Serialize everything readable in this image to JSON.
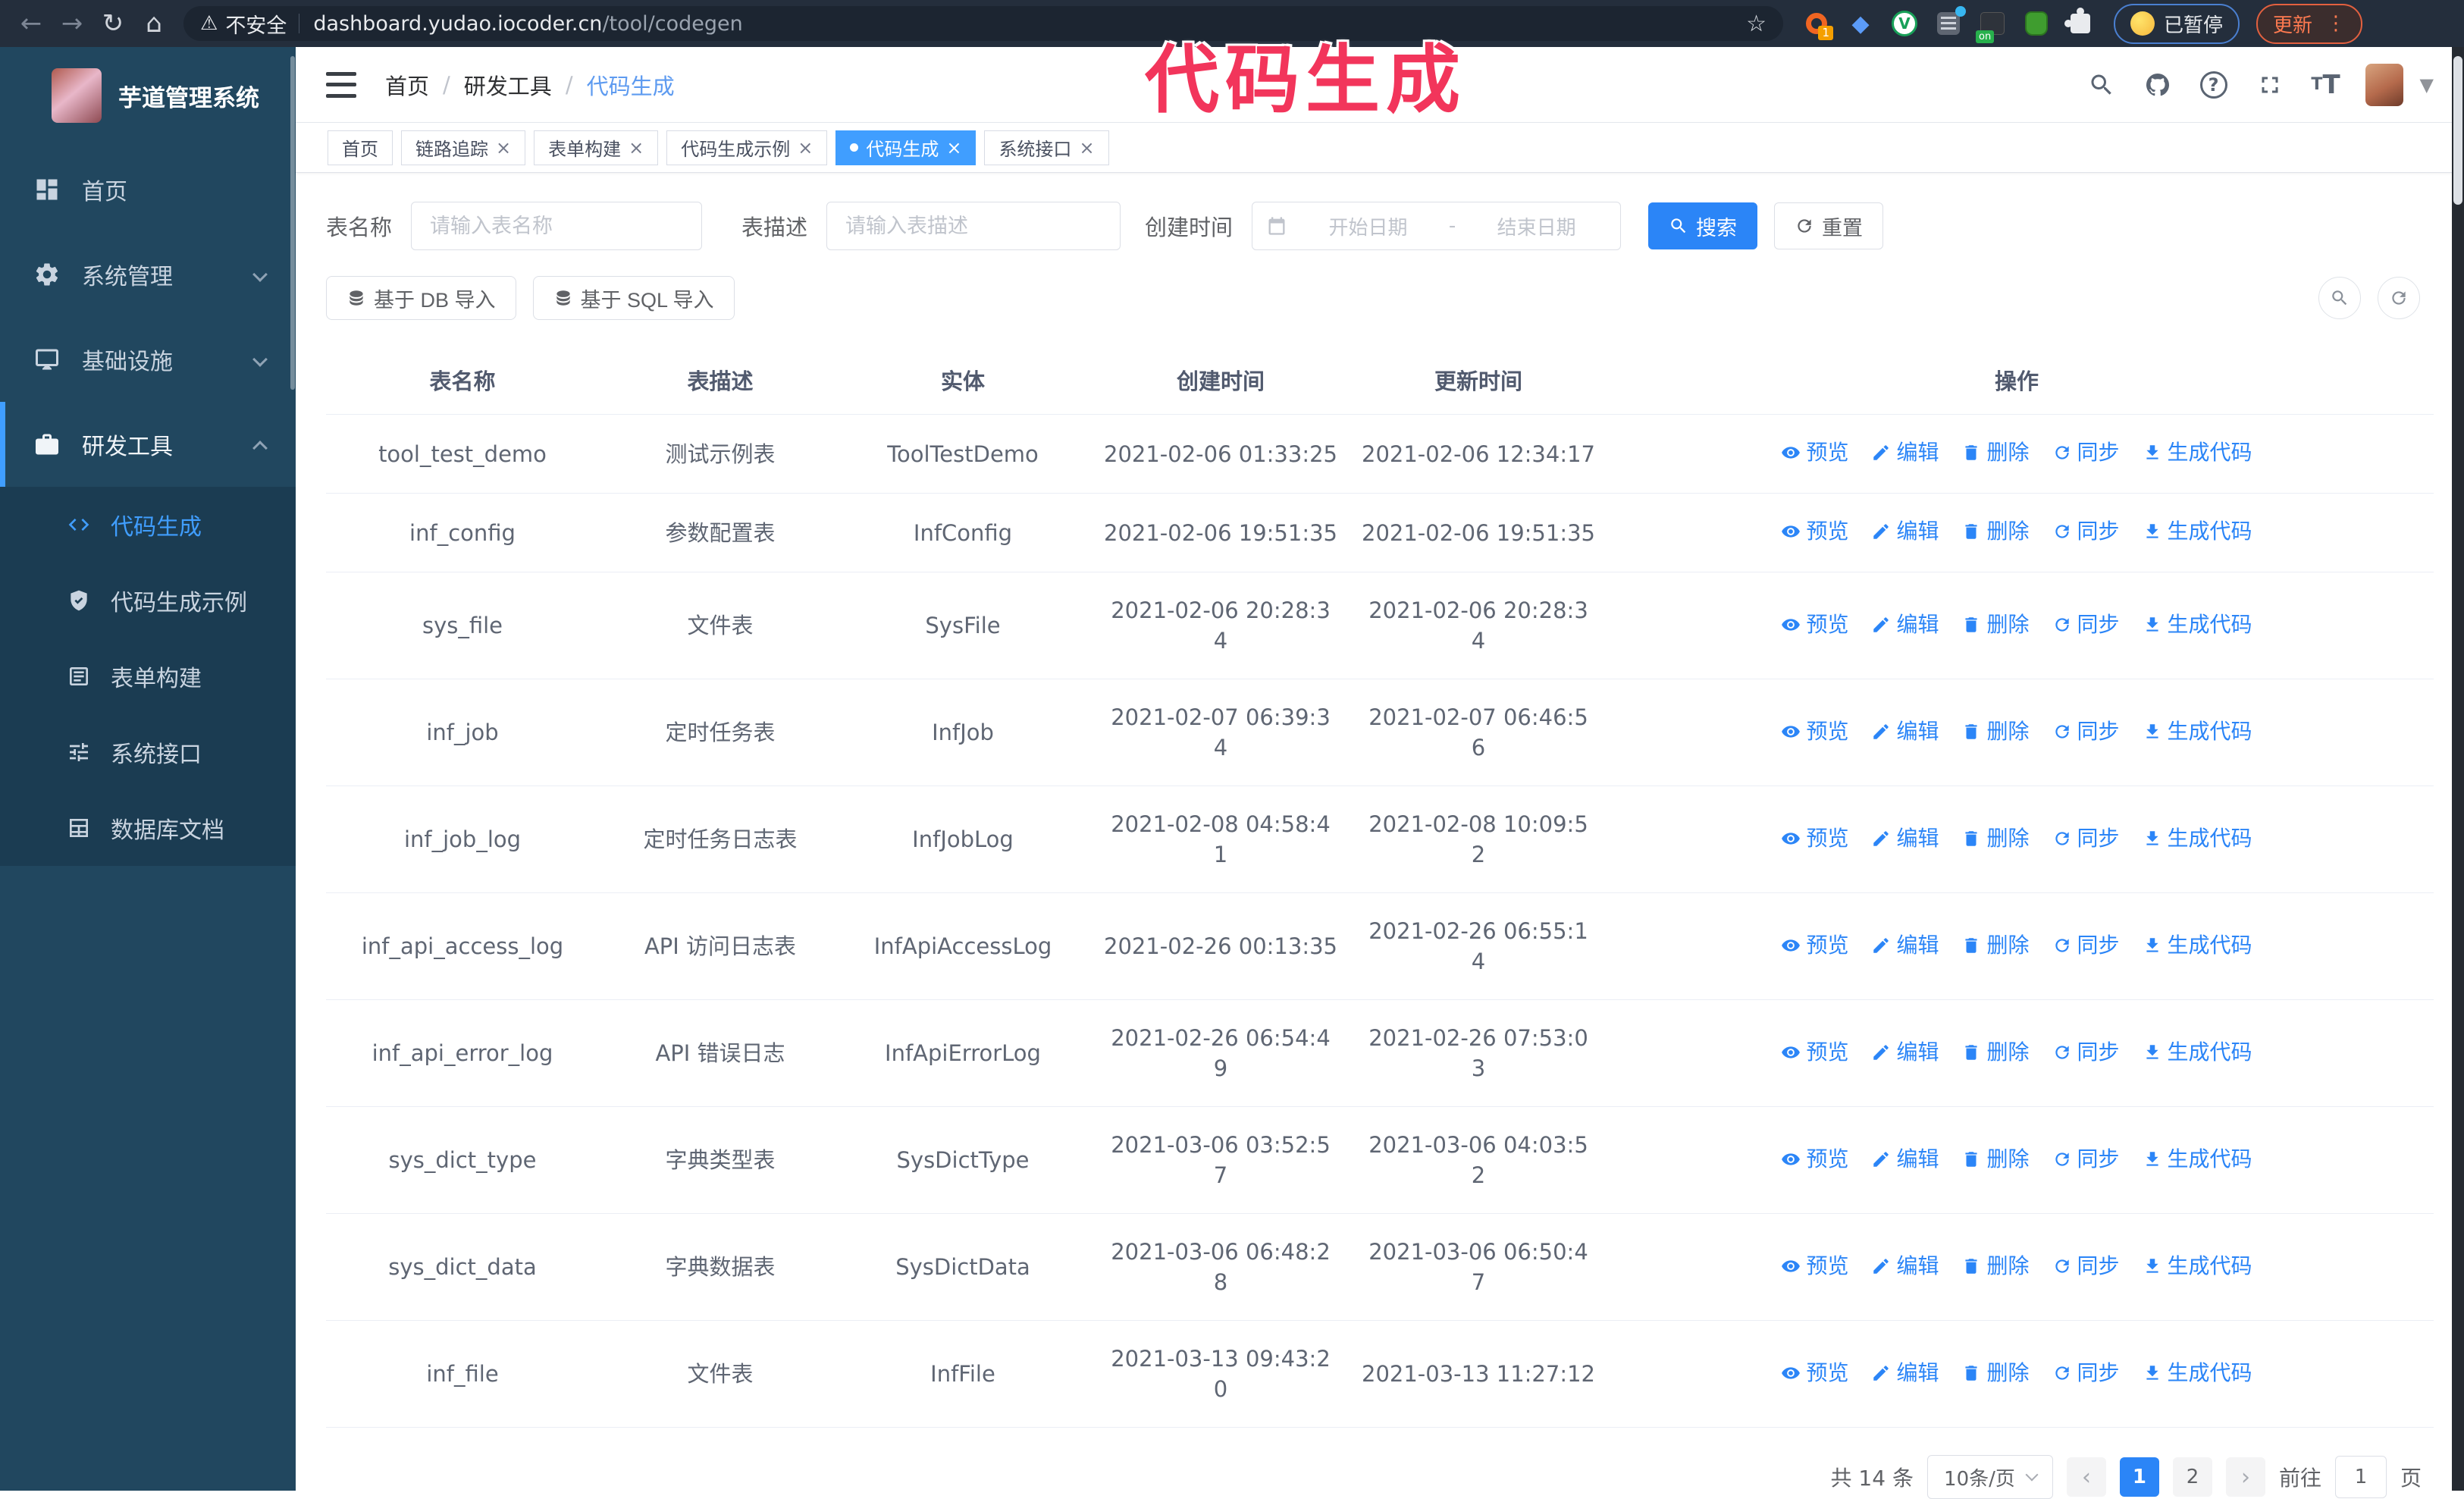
{
  "browser": {
    "insecure_label": "不安全",
    "url_host": "dashboard.yudao.iocoder.cn",
    "url_path": "/tool/codegen",
    "extension_badge": "1",
    "extension_on_badge": "on",
    "paused_label": "已暂停",
    "update_label": "更新"
  },
  "overlay_title": "代码生成",
  "sidebar": {
    "app_title": "芋道管理系统",
    "items": [
      {
        "label": "首页"
      },
      {
        "label": "系统管理"
      },
      {
        "label": "基础设施"
      },
      {
        "label": "研发工具"
      }
    ],
    "sub_items": [
      {
        "label": "代码生成"
      },
      {
        "label": "代码生成示例"
      },
      {
        "label": "表单构建"
      },
      {
        "label": "系统接口"
      },
      {
        "label": "数据库文档"
      }
    ]
  },
  "breadcrumb": [
    "首页",
    "研发工具",
    "代码生成"
  ],
  "tabs": [
    {
      "label": "首页"
    },
    {
      "label": "链路追踪"
    },
    {
      "label": "表单构建"
    },
    {
      "label": "代码生成示例"
    },
    {
      "label": "代码生成"
    },
    {
      "label": "系统接口"
    }
  ],
  "filters": {
    "table_name_label": "表名称",
    "table_name_placeholder": "请输入表名称",
    "table_desc_label": "表描述",
    "table_desc_placeholder": "请输入表描述",
    "create_time_label": "创建时间",
    "start_placeholder": "开始日期",
    "range_separator": "-",
    "end_placeholder": "结束日期",
    "search_label": "搜索",
    "reset_label": "重置"
  },
  "toolbar": {
    "import_db_label": "基于 DB 导入",
    "import_sql_label": "基于 SQL 导入"
  },
  "table": {
    "columns": [
      "表名称",
      "表描述",
      "实体",
      "创建时间",
      "更新时间",
      "操作"
    ],
    "row_actions": [
      "预览",
      "编辑",
      "删除",
      "同步",
      "生成代码"
    ],
    "rows": [
      {
        "name": "tool_test_demo",
        "desc": "测试示例表",
        "entity": "ToolTestDemo",
        "created": [
          "2021-02-06 01:33:25"
        ],
        "updated": [
          "2021-02-06 12:34:17"
        ]
      },
      {
        "name": "inf_config",
        "desc": "参数配置表",
        "entity": "InfConfig",
        "created": [
          "2021-02-06 19:51:35"
        ],
        "updated": [
          "2021-02-06 19:51:35"
        ]
      },
      {
        "name": "sys_file",
        "desc": "文件表",
        "entity": "SysFile",
        "created": [
          "2021-02-06 20:28:3",
          "4"
        ],
        "updated": [
          "2021-02-06 20:28:3",
          "4"
        ]
      },
      {
        "name": "inf_job",
        "desc": "定时任务表",
        "entity": "InfJob",
        "created": [
          "2021-02-07 06:39:3",
          "4"
        ],
        "updated": [
          "2021-02-07 06:46:5",
          "6"
        ]
      },
      {
        "name": "inf_job_log",
        "desc": "定时任务日志表",
        "entity": "InfJobLog",
        "created": [
          "2021-02-08 04:58:4",
          "1"
        ],
        "updated": [
          "2021-02-08 10:09:5",
          "2"
        ]
      },
      {
        "name": "inf_api_access_log",
        "desc": "API 访问日志表",
        "entity": "InfApiAccessLog",
        "created": [
          "2021-02-26 00:13:35"
        ],
        "updated": [
          "2021-02-26 06:55:1",
          "4"
        ]
      },
      {
        "name": "inf_api_error_log",
        "desc": "API 错误日志",
        "entity": "InfApiErrorLog",
        "created": [
          "2021-02-26 06:54:4",
          "9"
        ],
        "updated": [
          "2021-02-26 07:53:0",
          "3"
        ]
      },
      {
        "name": "sys_dict_type",
        "desc": "字典类型表",
        "entity": "SysDictType",
        "created": [
          "2021-03-06 03:52:5",
          "7"
        ],
        "updated": [
          "2021-03-06 04:03:5",
          "2"
        ]
      },
      {
        "name": "sys_dict_data",
        "desc": "字典数据表",
        "entity": "SysDictData",
        "created": [
          "2021-03-06 06:48:2",
          "8"
        ],
        "updated": [
          "2021-03-06 06:50:4",
          "7"
        ]
      },
      {
        "name": "inf_file",
        "desc": "文件表",
        "entity": "InfFile",
        "created": [
          "2021-03-13 09:43:2",
          "0"
        ],
        "updated": [
          "2021-03-13 11:27:12"
        ]
      }
    ]
  },
  "pagination": {
    "total": "共 14 条",
    "page_size": "10条/页",
    "pages": [
      "1",
      "2"
    ],
    "current": "1",
    "goto_label": "前往",
    "goto_value": "1",
    "page_unit": "页"
  },
  "colors": {
    "primary": "#2b85f7",
    "active_tab": "#409eff",
    "sidebar_bg": "#21475f",
    "submenu_bg": "#1b3c52",
    "overlay_pink": "#f2355b"
  }
}
